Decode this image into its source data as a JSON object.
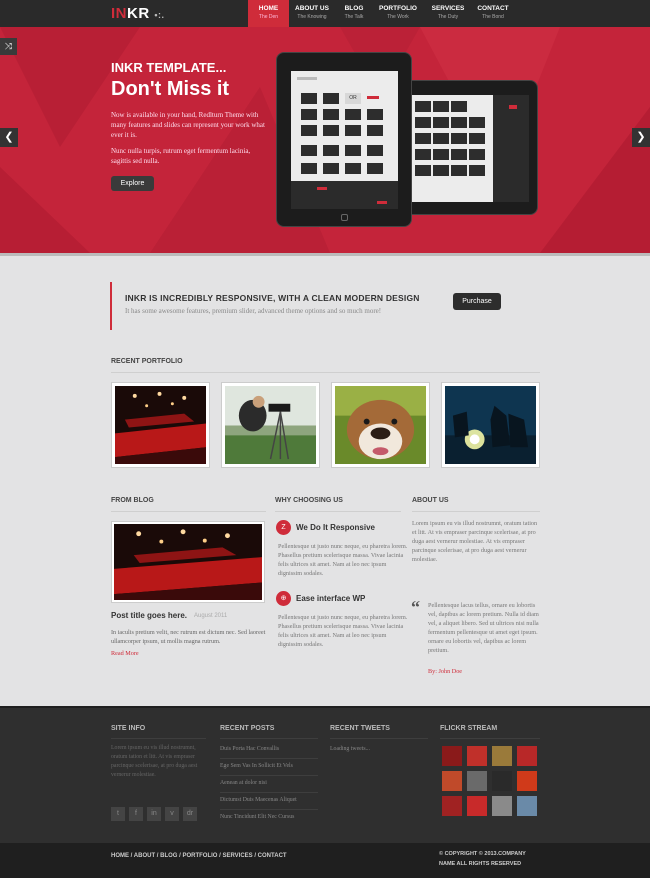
{
  "brand": {
    "logo_main": "INKR",
    "logo_accent": "IN",
    "logo_rest": "KR",
    "logo_dots": "•:."
  },
  "nav": [
    {
      "label": "HOME",
      "sub": "The Den"
    },
    {
      "label": "ABOUT US",
      "sub": "The Knowing"
    },
    {
      "label": "BLOG",
      "sub": "The Talk"
    },
    {
      "label": "PORTFOLIO",
      "sub": "The Work"
    },
    {
      "label": "SERVICES",
      "sub": "The Duty"
    },
    {
      "label": "CONTACT",
      "sub": "The Bond"
    }
  ],
  "hero": {
    "kicker": "INKR TEMPLATE...",
    "headline": "Don't Miss it",
    "p1": "Now is available in your hand, Redlturn Theme with many features and slides can represent your work what ever it is.",
    "p2": "Nunc nulla turpis, rutrum eget fermentum lacinia, sagittis sed nulla.",
    "cta": "Explore",
    "prev": "❮",
    "next": "❯",
    "shuffle": "⤨",
    "screen_label": "OR"
  },
  "callout": {
    "title": "INKR IS INCREDIBLY RESPONSIVE, WITH A CLEAN MODERN DESIGN",
    "subtitle": "It has some awesome features, premium slider, advanced theme options and so much more!",
    "button": "Purchase"
  },
  "portfolio": {
    "title": "RECENT PORTFOLIO"
  },
  "blog": {
    "title": "FROM BLOG",
    "post_title": "Post title goes here.",
    "post_date": "August 2011",
    "post_text": "In iaculis pretium velit, nec rutrum est dictum nec. Sed laoreet ullamcorper ipsum, ut mollis magna rutrum.",
    "read_more": "Read More"
  },
  "why": {
    "title": "WHY CHOOSING US",
    "items": [
      {
        "icon": "Z",
        "title": "We Do It Responsive",
        "text": "Pellentesque ut justo nunc neque, eu pharetra lorem. Phasellus pretium scelerisque massa. Vivae lacinia felis ultrices sit amet. Nam at leo nec ipsum dignissim sodales."
      },
      {
        "icon": "⊕",
        "title": "Ease interface WP",
        "text": "Pellentesque ut justo nunc neque, eu pharetra lorem. Phasellus pretium scelerisque massa. Vivae lacinia felis ultrices sit amet. Nam at leo nec ipsum dignissim sodales."
      }
    ]
  },
  "about": {
    "title": "ABOUT US",
    "text": "Lorem ipsum eu vis illud nostrumnt, oratum tation et litt. At vis empraser parcinque scelerisae, at pro duga aest vernerur molestiae. At vis empraser parcinque scelerisae, at pro duga aest vernerur molestiae.",
    "quote_mark": "“",
    "quote": "Pellentesque lacus tellus, ornare eu lobortis vel, dapibus ac lorem pretium. Nulla id diam vel, a aliquet libero. Sed ut ultrices nisi nulla fermentum pellentesque ut amet eget ipsum. ornare eu lobortis vel, dapibus ac lorem pretium.",
    "author": "By: John Doe"
  },
  "footer": {
    "site_info": {
      "title": "SITE INFO",
      "text": "Lorem ipsum eu vis illud nostrumnt, oratum tation et litt. At vis empraser parcinque scelerisae, at pro duga aest vernerur molestiae."
    },
    "recent_posts": {
      "title": "RECENT POSTS",
      "items": [
        "Duis Porta Hac Convallis",
        "Ege Sem Vas In Sollicit Et Vels",
        "Aenean at dolor nisi",
        "Dictumst Duis Maecenas Aliquet",
        "Nunc Tincidunt Elit Nec Cursus"
      ]
    },
    "recent_tweets": {
      "title": "RECENT TWEETS",
      "text": "Loading tweets..."
    },
    "flickr": {
      "title": "FLICKR STREAM"
    },
    "social": [
      "t",
      "f",
      "in",
      "v",
      "dr"
    ]
  },
  "bottom": {
    "links": "HOME / ABOUT / BLOG / PORTFOLIO / SERVICES / CONTACT",
    "copyright": "© COPYRIGHT © 2013.COMPANY",
    "rights": "NAME ALL RIGHTS RESERVED"
  },
  "colors": {
    "accent": "#cf2c3a",
    "hero_bg": "#c4243a",
    "dark": "#2a2a2a",
    "footer_bg": "#2f2f2f"
  }
}
